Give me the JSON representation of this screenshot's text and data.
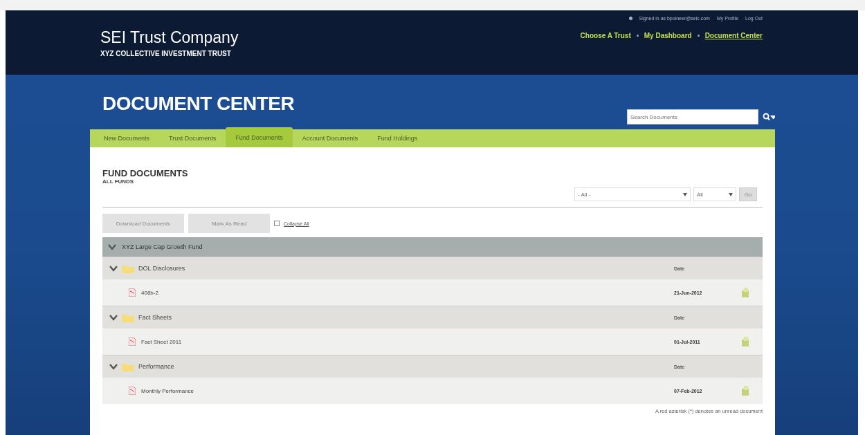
{
  "header": {
    "brand": "SEI Trust Company",
    "subtitle": "XYZ COLLECTIVE INVESTMENT TRUST",
    "user_links": [
      "Signed in as bpoineer@seic.com",
      "My Profile",
      "Log Out"
    ],
    "nav": [
      {
        "label": "Choose A Trust",
        "selected": false
      },
      {
        "label": "My Dashboard",
        "selected": false
      },
      {
        "label": "Document Center",
        "selected": true
      }
    ]
  },
  "page_title": "DOCUMENT CENTER",
  "search": {
    "placeholder": "Search Documents"
  },
  "tabs": [
    {
      "label": "New Documents",
      "selected": false
    },
    {
      "label": "Trust Documents",
      "selected": false
    },
    {
      "label": "Fund Documents",
      "selected": true
    },
    {
      "label": "Account Documents",
      "selected": false
    },
    {
      "label": "Fund Holdings",
      "selected": false
    }
  ],
  "section": {
    "title": "FUND DOCUMENTS",
    "subtitle": "ALL FUNDS"
  },
  "filters": {
    "fund": "- All -",
    "year": "All",
    "go": "Go"
  },
  "actions": {
    "download": "Download Documents",
    "mark_read": "Mark As Read",
    "collapse": {
      "label": "Collapse All",
      "checked": false
    }
  },
  "fund": {
    "name": "XYZ Large Cap Growth Fund",
    "expanded": true,
    "folders": [
      {
        "name": "DOL Disclosures",
        "expanded": true,
        "date_header": "Date",
        "documents": [
          {
            "name": "408b-2",
            "date": "21-Jun-2012"
          }
        ]
      },
      {
        "name": "Fact Sheets",
        "expanded": true,
        "date_header": "Date",
        "documents": [
          {
            "name": "Fact Sheet 2011",
            "date": "01-Jul-2011"
          }
        ]
      },
      {
        "name": "Performance",
        "expanded": true,
        "date_header": "Date",
        "documents": [
          {
            "name": "Monthly Performance",
            "date": "07-Feb-2012"
          }
        ]
      }
    ]
  },
  "footnote": "A red asterisk (*) denotes an unread document"
}
